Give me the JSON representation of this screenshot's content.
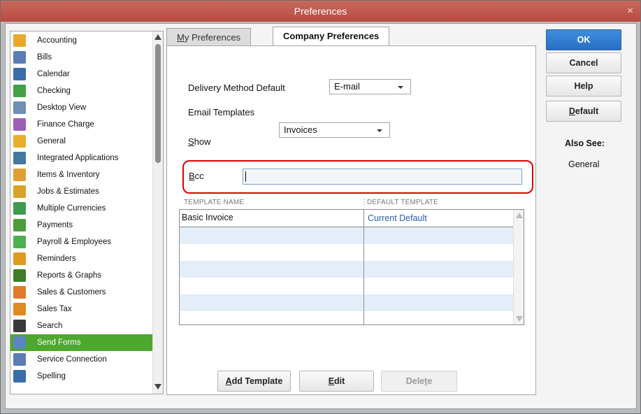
{
  "window": {
    "title": "Preferences",
    "close_glyph": "×"
  },
  "sidebar": {
    "items": [
      {
        "label": "Accounting",
        "icon": "accounting-icon",
        "color": "#e8a92a"
      },
      {
        "label": "Bills",
        "icon": "bills-icon",
        "color": "#5a7db5"
      },
      {
        "label": "Calendar",
        "icon": "calendar-icon",
        "color": "#3a6ea8"
      },
      {
        "label": "Checking",
        "icon": "checking-icon",
        "color": "#43a047"
      },
      {
        "label": "Desktop View",
        "icon": "desktop-view-icon",
        "color": "#6f8fb5"
      },
      {
        "label": "Finance Charge",
        "icon": "finance-charge-icon",
        "color": "#9c5fb5"
      },
      {
        "label": "General",
        "icon": "general-icon",
        "color": "#e8b02a"
      },
      {
        "label": "Integrated Applications",
        "icon": "integrated-apps-icon",
        "color": "#44799d"
      },
      {
        "label": "Items & Inventory",
        "icon": "items-inventory-icon",
        "color": "#e0a030"
      },
      {
        "label": "Jobs & Estimates",
        "icon": "jobs-estimates-icon",
        "color": "#d9a325"
      },
      {
        "label": "Multiple Currencies",
        "icon": "currencies-icon",
        "color": "#3f9b4e"
      },
      {
        "label": "Payments",
        "icon": "payments-icon",
        "color": "#4c9d3a"
      },
      {
        "label": "Payroll & Employees",
        "icon": "payroll-icon",
        "color": "#4caf50"
      },
      {
        "label": "Reminders",
        "icon": "reminders-icon",
        "color": "#e09a20"
      },
      {
        "label": "Reports & Graphs",
        "icon": "reports-icon",
        "color": "#3d7d2a"
      },
      {
        "label": "Sales & Customers",
        "icon": "sales-customers-icon",
        "color": "#e07a2a"
      },
      {
        "label": "Sales Tax",
        "icon": "sales-tax-icon",
        "color": "#e08a20"
      },
      {
        "label": "Search",
        "icon": "search-icon",
        "color": "#3a3a3a"
      },
      {
        "label": "Send Forms",
        "icon": "send-forms-icon",
        "color": "#5a86c2"
      },
      {
        "label": "Service Connection",
        "icon": "service-connection-icon",
        "color": "#5a7db5"
      },
      {
        "label": "Spelling",
        "icon": "spelling-icon",
        "color": "#3a6ea8"
      }
    ],
    "selected_index": 18,
    "selected_color": "#4ea72f"
  },
  "tabs": {
    "my_prefs_first": "M",
    "my_prefs_rest": "y Preferences",
    "company_prefs": "Company Preferences"
  },
  "form": {
    "delivery_label": "Delivery Method Default",
    "delivery_value": "E-mail",
    "email_templates_label": "Email Templates",
    "show_label_first": "S",
    "show_label_rest": "how",
    "show_value": "Invoices",
    "bcc_label_first": "B",
    "bcc_label_rest": "cc",
    "bcc_value": ""
  },
  "table": {
    "columns": [
      "TEMPLATE NAME",
      "DEFAULT TEMPLATE"
    ],
    "rows": [
      {
        "name": "Basic Invoice",
        "default": "Current Default"
      }
    ],
    "link_color": "#2a5db0"
  },
  "buttons": {
    "add_template_first": "A",
    "add_template_rest": "dd Template",
    "edit_first": "E",
    "edit_rest": "dit",
    "delete_pre": "Dele",
    "delete_u": "t",
    "delete_post": "e",
    "ok": "OK",
    "cancel": "Cancel",
    "help": "Help",
    "default_first": "D",
    "default_rest": "efault"
  },
  "also_see": {
    "heading": "Also See:",
    "general": "General"
  }
}
